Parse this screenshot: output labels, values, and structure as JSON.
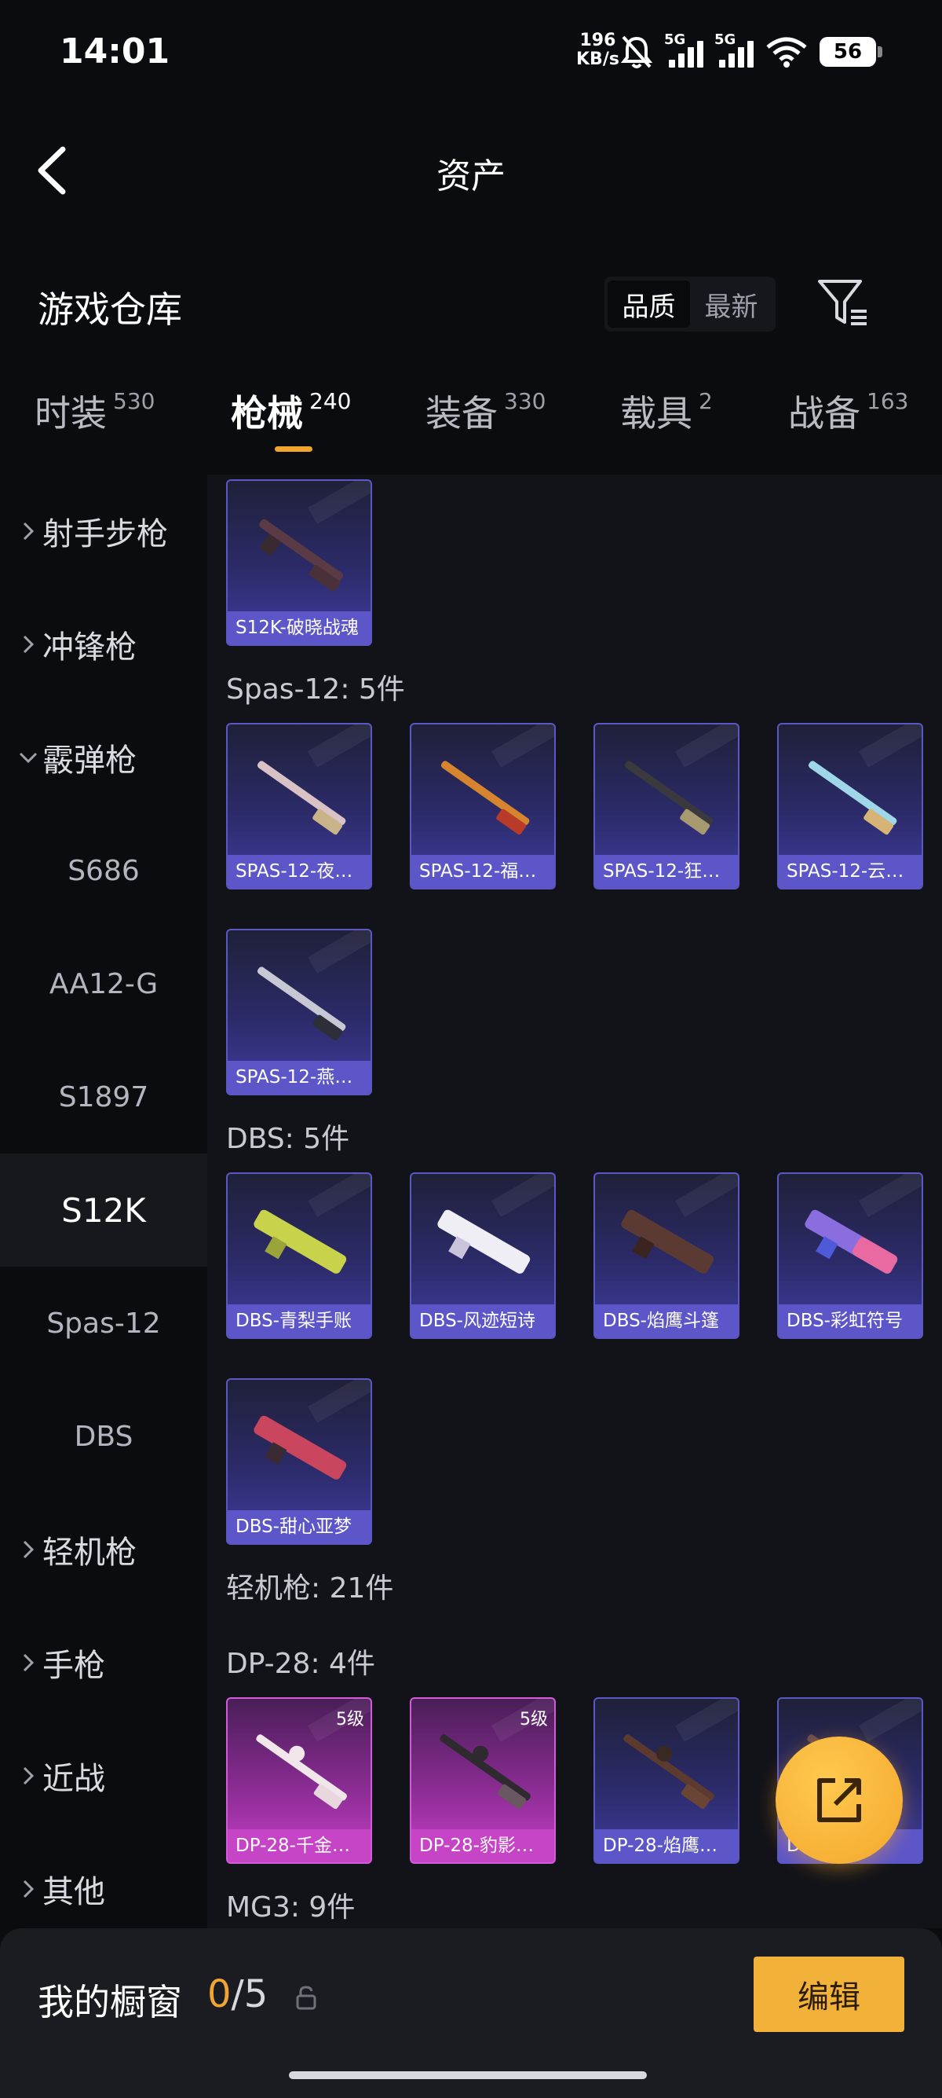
{
  "status_bar": {
    "time": "14:01",
    "net_speed_value": "196",
    "net_speed_unit": "KB/s",
    "sim1": "5G",
    "sim2": "5G",
    "battery": "56"
  },
  "header": {
    "title": "资产",
    "back_icon": "chevron-left-icon"
  },
  "toolbar": {
    "title": "游戏仓库",
    "sort_options": [
      "品质",
      "最新"
    ],
    "sort_selected": "品质",
    "filter_icon": "filter-icon"
  },
  "tabs": [
    {
      "label": "时装",
      "count": "530"
    },
    {
      "label": "枪械",
      "count": "240",
      "active": true
    },
    {
      "label": "装备",
      "count": "330"
    },
    {
      "label": "载具",
      "count": "2"
    },
    {
      "label": "战备",
      "count": "163"
    }
  ],
  "sidebar": {
    "categories": [
      {
        "label": "射手步枪",
        "expanded": false
      },
      {
        "label": "冲锋枪",
        "expanded": false
      },
      {
        "label": "霰弹枪",
        "expanded": true
      },
      {
        "label": "轻机枪",
        "expanded": false
      },
      {
        "label": "手枪",
        "expanded": false
      },
      {
        "label": "近战",
        "expanded": false
      },
      {
        "label": "其他",
        "expanded": false
      }
    ],
    "subitems": [
      "S686",
      "AA12-G",
      "S1897",
      "S12K",
      "Spas-12",
      "DBS"
    ],
    "active_subitem": "S12K"
  },
  "content": {
    "s12k_cards": [
      "S12K-破晓战魂"
    ],
    "spas_title": "Spas-12: 5件",
    "spas_cards": [
      "SPAS-12-夜…",
      "SPAS-12-福…",
      "SPAS-12-狂…",
      "SPAS-12-云…",
      "SPAS-12-燕…"
    ],
    "dbs_title": "DBS: 5件",
    "dbs_cards": [
      "DBS-青梨手账",
      "DBS-风迹短诗",
      "DBS-焰鹰斗篷",
      "DBS-彩虹符号",
      "DBS-甜心亚梦"
    ],
    "lmg_title": "轻机枪: 21件",
    "dp28_title": "DP-28: 4件",
    "dp28_cards": [
      "DP-28-千金…",
      "DP-28-豹影…",
      "DP-28-焰鹰…",
      "DP-28-…"
    ],
    "dp28_levels": [
      "5级",
      "5级"
    ],
    "mg3_title": "MG3: 9件"
  },
  "fab": {
    "icon": "share-external-icon"
  },
  "bottom_bar": {
    "title": "我的橱窗",
    "count_current": "0",
    "count_sep": "/",
    "count_total": "5",
    "lock_icon": "lock-icon",
    "edit_label": "编辑"
  },
  "colors": {
    "accent": "#f0a531",
    "card_purple": "#5d56c9",
    "card_pink": "#c545c6",
    "background": "#0b0c10",
    "panel": "#121319"
  }
}
